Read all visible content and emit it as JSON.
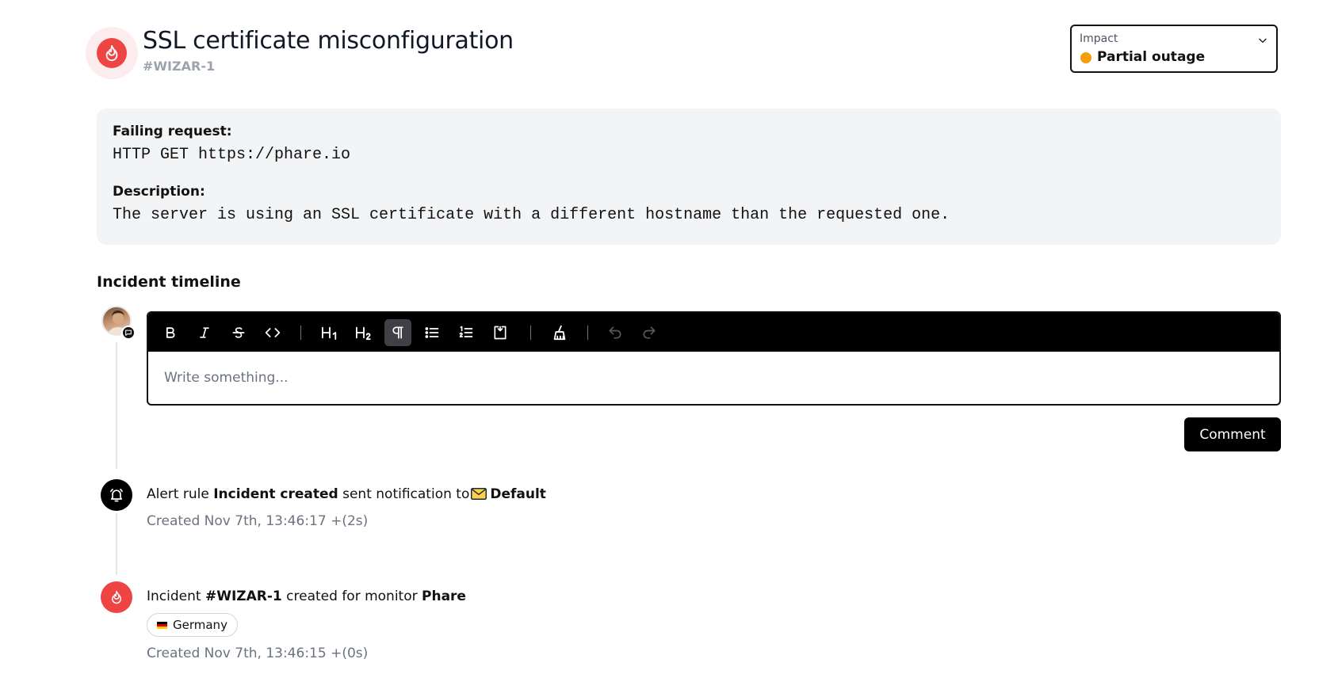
{
  "incident": {
    "title": "SSL certificate misconfiguration",
    "id": "#WIZAR-1"
  },
  "impact": {
    "label": "Impact",
    "value": "Partial outage",
    "status_color": "#f59e0b"
  },
  "details": {
    "failing_request_label": "Failing request:",
    "failing_request_value": "HTTP GET https://phare.io",
    "description_label": "Description:",
    "description_value": "The server is using an SSL certificate with a different hostname than the requested one."
  },
  "timeline": {
    "title": "Incident timeline",
    "editor": {
      "placeholder": "Write something...",
      "toolbar": [
        "bold-icon",
        "italic-icon",
        "strikethrough-icon",
        "code-icon",
        "heading-1-icon",
        "heading-2-icon",
        "paragraph-icon",
        "bullet-list-icon",
        "ordered-list-icon",
        "code-block-icon",
        "clear-format-icon",
        "undo-icon",
        "redo-icon"
      ]
    },
    "comment_button": "Comment",
    "events": [
      {
        "icon": "bell-icon",
        "prefix": "Alert rule",
        "rule": "Incident created",
        "middle": "sent notification to",
        "channel_icon": "envelope-icon",
        "channel": "Default",
        "meta": "Created Nov 7th, 13:46:17 +(2s)"
      },
      {
        "icon": "flame-icon",
        "prefix": "Incident",
        "incident": "#WIZAR-1",
        "middle": "created for monitor",
        "monitor": "Phare",
        "location": "Germany",
        "meta": "Created Nov 7th, 13:46:15 +(0s)"
      }
    ]
  },
  "colors": {
    "danger": "#ef4444",
    "danger_soft": "#fdeced",
    "accent": "#000000",
    "card_bg": "#f3f4f6"
  }
}
